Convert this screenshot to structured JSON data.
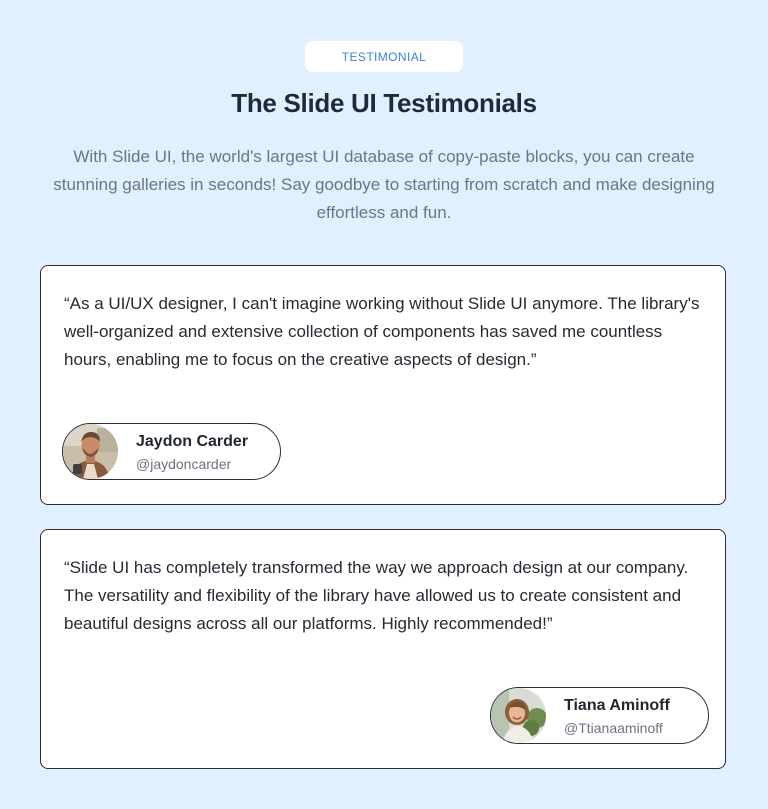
{
  "header": {
    "badge": "TESTIMONIAL",
    "title": "The Slide UI Testimonials",
    "subtitle": "With Slide UI, the world's largest UI database of copy-paste blocks, you can create stunning galleries in seconds! Say goodbye to starting from scratch and make designing effortless and fun."
  },
  "testimonials": [
    {
      "quote": "“As a UI/UX designer, I can't imagine working without Slide UI anymore. The library's well-organized and extensive collection of components has saved me countless hours, enabling me to focus on the creative aspects of design.”",
      "name": "Jaydon Carder",
      "handle": "@jaydoncarder",
      "avatar_icon": "man-avatar-photo"
    },
    {
      "quote": "“Slide UI has completely transformed the way we approach design at our company. The versatility and flexibility of the library have allowed us to create consistent and beautiful designs across all our platforms. Highly recommended!”",
      "name": "Tiana Aminoff",
      "handle": "@Ttianaaminoff",
      "avatar_icon": "woman-avatar-photo"
    }
  ],
  "colors": {
    "background": "#e1f0fe",
    "badge_text": "#3b82d6",
    "title": "#1e2a3a",
    "subtitle": "#6b7684",
    "card_border": "#2a2f36"
  }
}
